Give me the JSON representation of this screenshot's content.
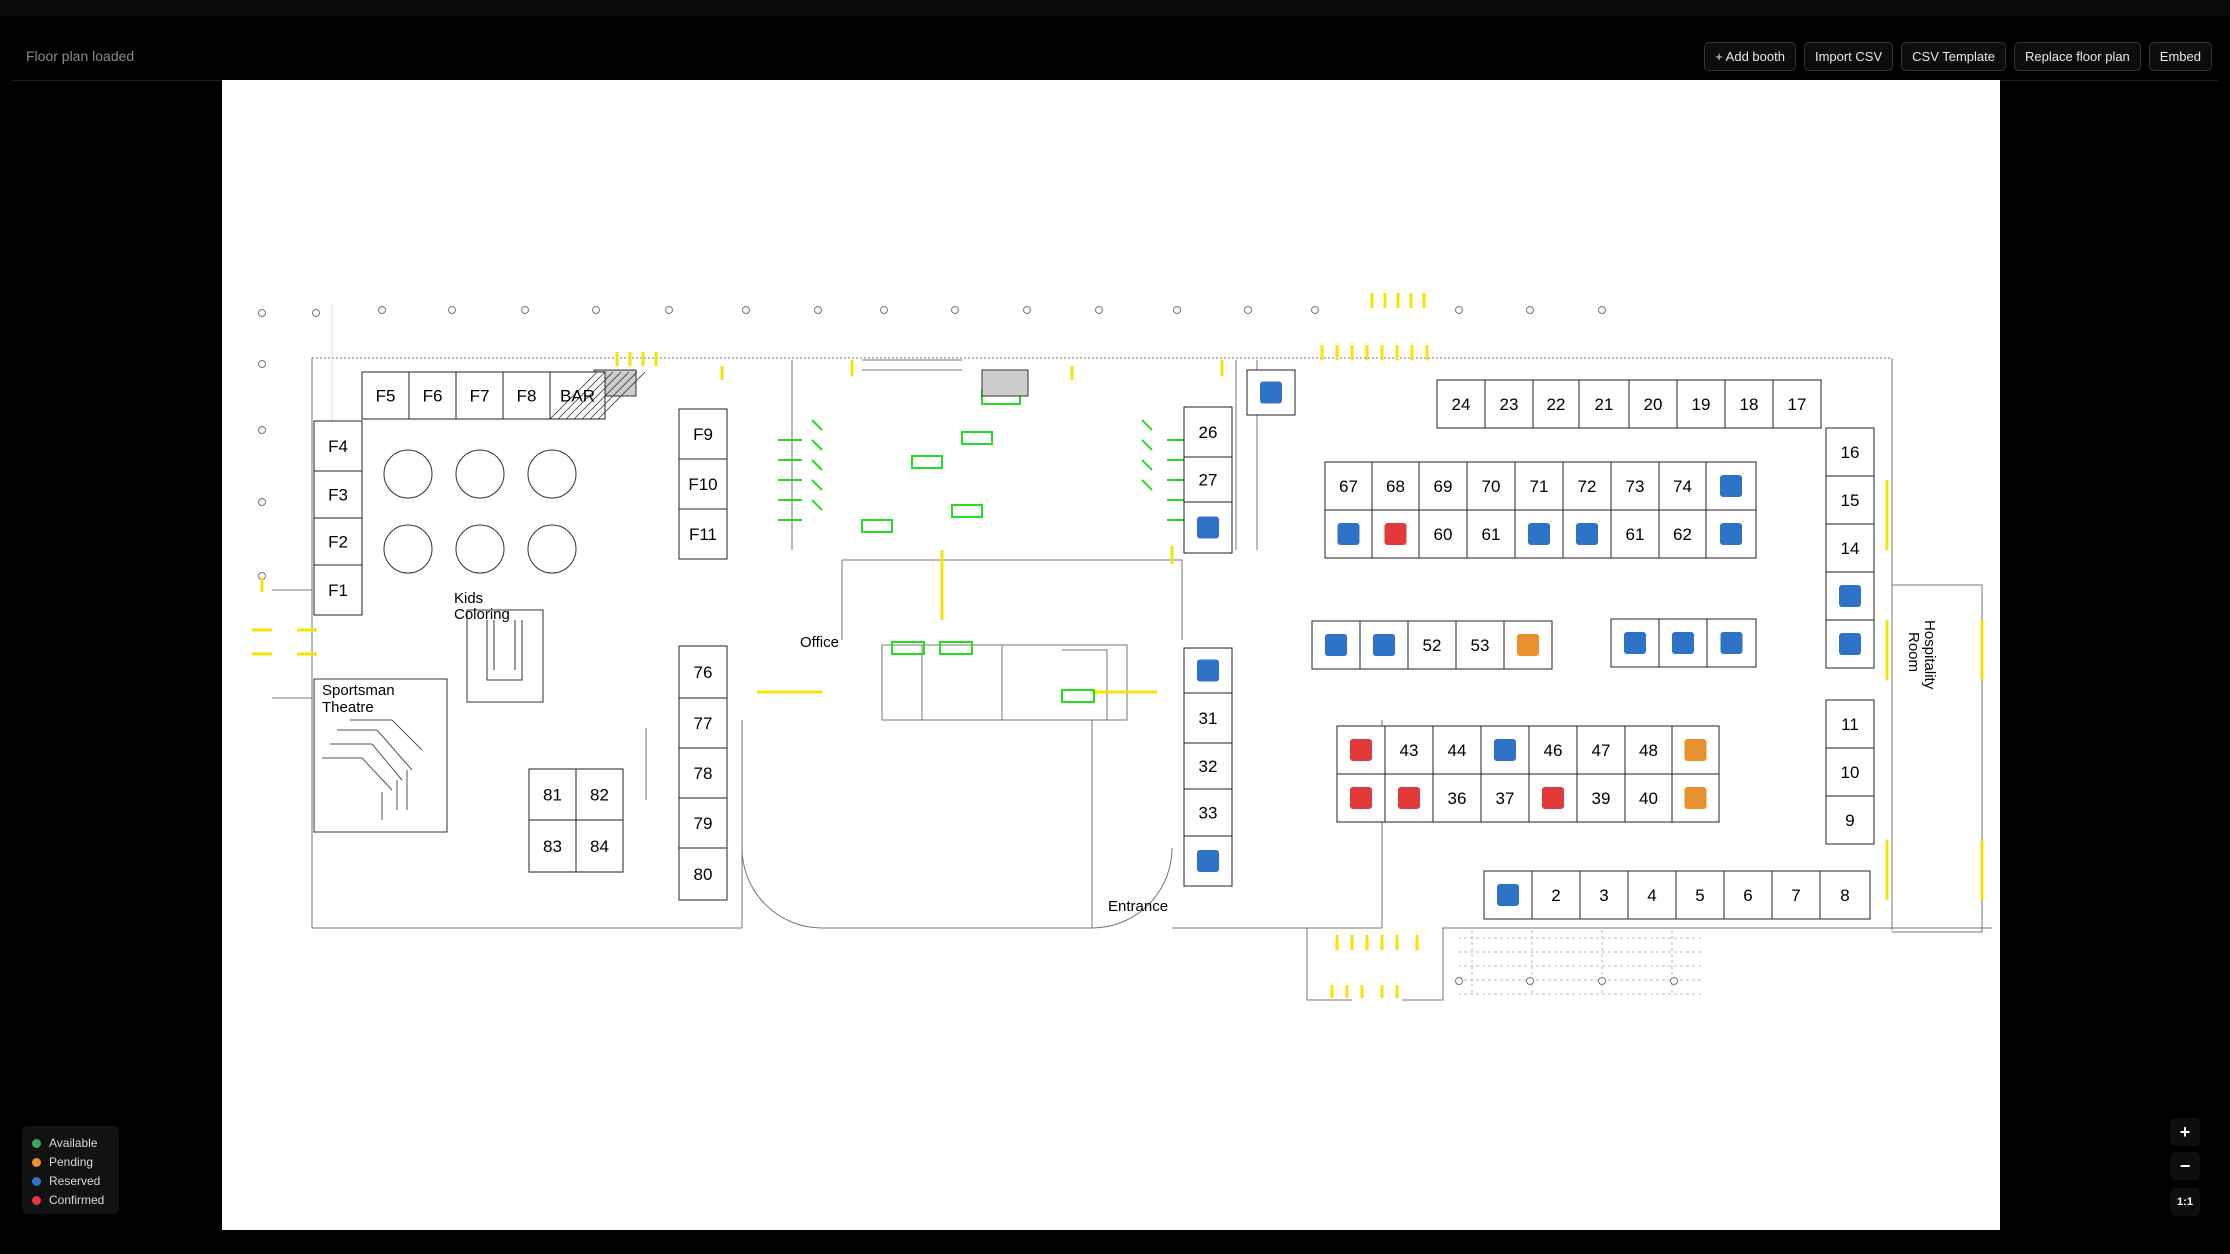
{
  "header": {
    "status": "Floor plan loaded",
    "toolbar": {
      "add_booth": "+ Add booth",
      "import_csv": "Import CSV",
      "csv_template": "CSV Template",
      "replace_floor_plan": "Replace floor plan",
      "embed": "Embed"
    }
  },
  "colors": {
    "available": "#3aa65a",
    "pending": "#e8912d",
    "reserved": "#2f73c9",
    "confirmed": "#e03a3a",
    "wall": "#777777",
    "accent_yellow": "#f2e600",
    "accent_green": "#22dd22"
  },
  "legend": [
    {
      "label": "Available",
      "status": "available"
    },
    {
      "label": "Pending",
      "status": "pending"
    },
    {
      "label": "Reserved",
      "status": "reserved"
    },
    {
      "label": "Confirmed",
      "status": "confirmed"
    }
  ],
  "zoom": {
    "in": "+",
    "out": "−",
    "reset": "1:1"
  },
  "floor_plan": {
    "labels": {
      "kids_coloring_1": "Kids",
      "kids_coloring_2": "Coloring",
      "sportsman_1": "Sportsman",
      "sportsman_2": "Theatre",
      "office": "Office",
      "hospitality_1": "Hospitality",
      "hospitality_2": "Room",
      "entrance": "Entrance"
    },
    "booths": [
      {
        "label": "F5",
        "status": null
      },
      {
        "label": "F6",
        "status": null
      },
      {
        "label": "F7",
        "status": null
      },
      {
        "label": "F8",
        "status": null
      },
      {
        "label": "BAR",
        "status": null
      },
      {
        "label": "F4",
        "status": null
      },
      {
        "label": "F3",
        "status": null
      },
      {
        "label": "F2",
        "status": null
      },
      {
        "label": "F1",
        "status": null
      },
      {
        "label": "F9",
        "status": null
      },
      {
        "label": "F10",
        "status": null
      },
      {
        "label": "F11",
        "status": null
      },
      {
        "label": "76",
        "status": null
      },
      {
        "label": "77",
        "status": null
      },
      {
        "label": "78",
        "status": null
      },
      {
        "label": "79",
        "status": null
      },
      {
        "label": "80",
        "status": null
      },
      {
        "label": "81",
        "status": null
      },
      {
        "label": "82",
        "status": null
      },
      {
        "label": "83",
        "status": null
      },
      {
        "label": "84",
        "status": null
      },
      {
        "label": "26",
        "status": null
      },
      {
        "label": "27",
        "status": null
      },
      {
        "label": "",
        "status": "reserved"
      },
      {
        "label": "",
        "status": "reserved"
      },
      {
        "label": "",
        "status": "reserved"
      },
      {
        "label": "31",
        "status": null
      },
      {
        "label": "32",
        "status": null
      },
      {
        "label": "33",
        "status": null
      },
      {
        "label": "",
        "status": "reserved"
      },
      {
        "label": "24",
        "status": null
      },
      {
        "label": "23",
        "status": null
      },
      {
        "label": "22",
        "status": null
      },
      {
        "label": "21",
        "status": null
      },
      {
        "label": "20",
        "status": null
      },
      {
        "label": "19",
        "status": null
      },
      {
        "label": "18",
        "status": null
      },
      {
        "label": "17",
        "status": null
      },
      {
        "label": "67",
        "status": null
      },
      {
        "label": "68",
        "status": null
      },
      {
        "label": "69",
        "status": null
      },
      {
        "label": "70",
        "status": null
      },
      {
        "label": "71",
        "status": null
      },
      {
        "label": "72",
        "status": null
      },
      {
        "label": "73",
        "status": null
      },
      {
        "label": "74",
        "status": null
      },
      {
        "label": "",
        "status": "reserved"
      },
      {
        "label": "",
        "status": "reserved"
      },
      {
        "label": "",
        "status": "confirmed"
      },
      {
        "label": "60",
        "status": null
      },
      {
        "label": "61",
        "status": null
      },
      {
        "label": "",
        "status": "reserved"
      },
      {
        "label": "",
        "status": "reserved"
      },
      {
        "label": "61",
        "status": null
      },
      {
        "label": "62",
        "status": null
      },
      {
        "label": "",
        "status": "reserved"
      },
      {
        "label": "",
        "status": "reserved"
      },
      {
        "label": "",
        "status": "reserved"
      },
      {
        "label": "52",
        "status": null
      },
      {
        "label": "53",
        "status": null
      },
      {
        "label": "",
        "status": "pending"
      },
      {
        "label": "",
        "status": "reserved"
      },
      {
        "label": "",
        "status": "reserved"
      },
      {
        "label": "",
        "status": "reserved"
      },
      {
        "label": "",
        "status": "confirmed"
      },
      {
        "label": "43",
        "status": null
      },
      {
        "label": "44",
        "status": null
      },
      {
        "label": "",
        "status": "reserved"
      },
      {
        "label": "46",
        "status": null
      },
      {
        "label": "47",
        "status": null
      },
      {
        "label": "48",
        "status": null
      },
      {
        "label": "",
        "status": "pending"
      },
      {
        "label": "",
        "status": "confirmed"
      },
      {
        "label": "",
        "status": "confirmed"
      },
      {
        "label": "36",
        "status": null
      },
      {
        "label": "37",
        "status": null
      },
      {
        "label": "",
        "status": "confirmed"
      },
      {
        "label": "39",
        "status": null
      },
      {
        "label": "40",
        "status": null
      },
      {
        "label": "",
        "status": "pending"
      },
      {
        "label": "16",
        "status": null
      },
      {
        "label": "15",
        "status": null
      },
      {
        "label": "14",
        "status": null
      },
      {
        "label": "",
        "status": "reserved"
      },
      {
        "label": "",
        "status": "reserved"
      },
      {
        "label": "11",
        "status": null
      },
      {
        "label": "10",
        "status": null
      },
      {
        "label": "9",
        "status": null
      },
      {
        "label": "",
        "status": "reserved"
      },
      {
        "label": "2",
        "status": null
      },
      {
        "label": "3",
        "status": null
      },
      {
        "label": "4",
        "status": null
      },
      {
        "label": "5",
        "status": null
      },
      {
        "label": "6",
        "status": null
      },
      {
        "label": "7",
        "status": null
      },
      {
        "label": "8",
        "status": null
      }
    ]
  }
}
